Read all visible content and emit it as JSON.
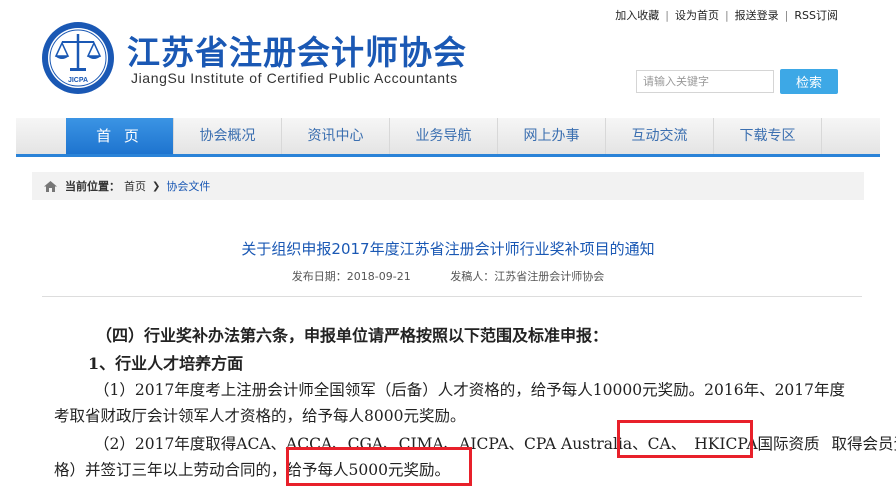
{
  "site": {
    "name_cn": "江苏省注册会计师协会",
    "name_en": "JiangSu Institute of Certified Public Accountants",
    "emblem_text": "JICPA"
  },
  "toplinks": [
    "加入收藏",
    "设为首页",
    "报送登录",
    "RSS订阅"
  ],
  "search": {
    "placeholder": "请输入关键字",
    "button": "检索"
  },
  "nav": [
    "首 页",
    "协会概况",
    "资讯中心",
    "业务导航",
    "网上办事",
    "互动交流",
    "下载专区"
  ],
  "breadcrumb": {
    "label": "当前位置：",
    "home": "首页",
    "current": "协会文件"
  },
  "article": {
    "title": "关于组织申报2017年度江苏省注册会计师行业奖补项目的通知",
    "publish_date": "发布日期：2018-09-21",
    "author": "发稿人：江苏省注册会计师协会"
  },
  "body": {
    "p1": "（四）行业奖补办法第六条，申报单位请严格按照以下范围及标准申报：",
    "p2": "1、行业人才培养方面",
    "p3a": "（1）2017年度考上注册会计师全国领军（后备）人才资格的，给予每人10000元奖励。2016年、2017年度",
    "p3b": "考取省财政厅会计领军人才资格的，给予每人8000元奖励。",
    "p4a_1": "（2）2017年度取得ACA、ACCA、CGA、CIMA、AICPA、CPA Australia、CA、",
    "p4a_hl": "HKICPA国际资质",
    "p4a_2": "取得会员资",
    "p4b_1": "格）并签订三年以上劳动合同的，",
    "p4b_hl": "给予每人5000元奖励。"
  }
}
